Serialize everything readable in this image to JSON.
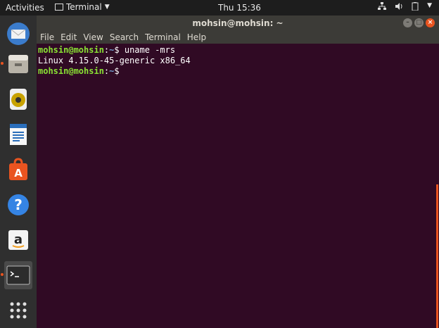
{
  "topbar": {
    "activities": "Activities",
    "app_menu_label": "Terminal",
    "clock": "Thu 15:36"
  },
  "dock": {
    "items": [
      {
        "name": "thunderbird-icon"
      },
      {
        "name": "files-icon"
      },
      {
        "name": "rhythmbox-icon"
      },
      {
        "name": "libreoffice-writer-icon"
      },
      {
        "name": "software-center-icon"
      },
      {
        "name": "help-icon"
      },
      {
        "name": "amazon-icon"
      },
      {
        "name": "terminal-icon"
      },
      {
        "name": "show-applications-icon"
      }
    ],
    "accent": "#e95420"
  },
  "window": {
    "title": "mohsin@mohsin: ~",
    "menu": [
      "File",
      "Edit",
      "View",
      "Search",
      "Terminal",
      "Help"
    ]
  },
  "terminal": {
    "lines": [
      {
        "user": "mohsin@mohsin",
        "sep": ":",
        "path": "~",
        "cmd": "$ uname -mrs"
      },
      {
        "output": "Linux 4.15.0-45-generic x86_64"
      },
      {
        "user": "mohsin@mohsin",
        "sep": ":",
        "path": "~",
        "cmd": "$ "
      }
    ],
    "background": "#300a24",
    "prompt_color": "#8ae234",
    "path_color": "#729fcf"
  }
}
